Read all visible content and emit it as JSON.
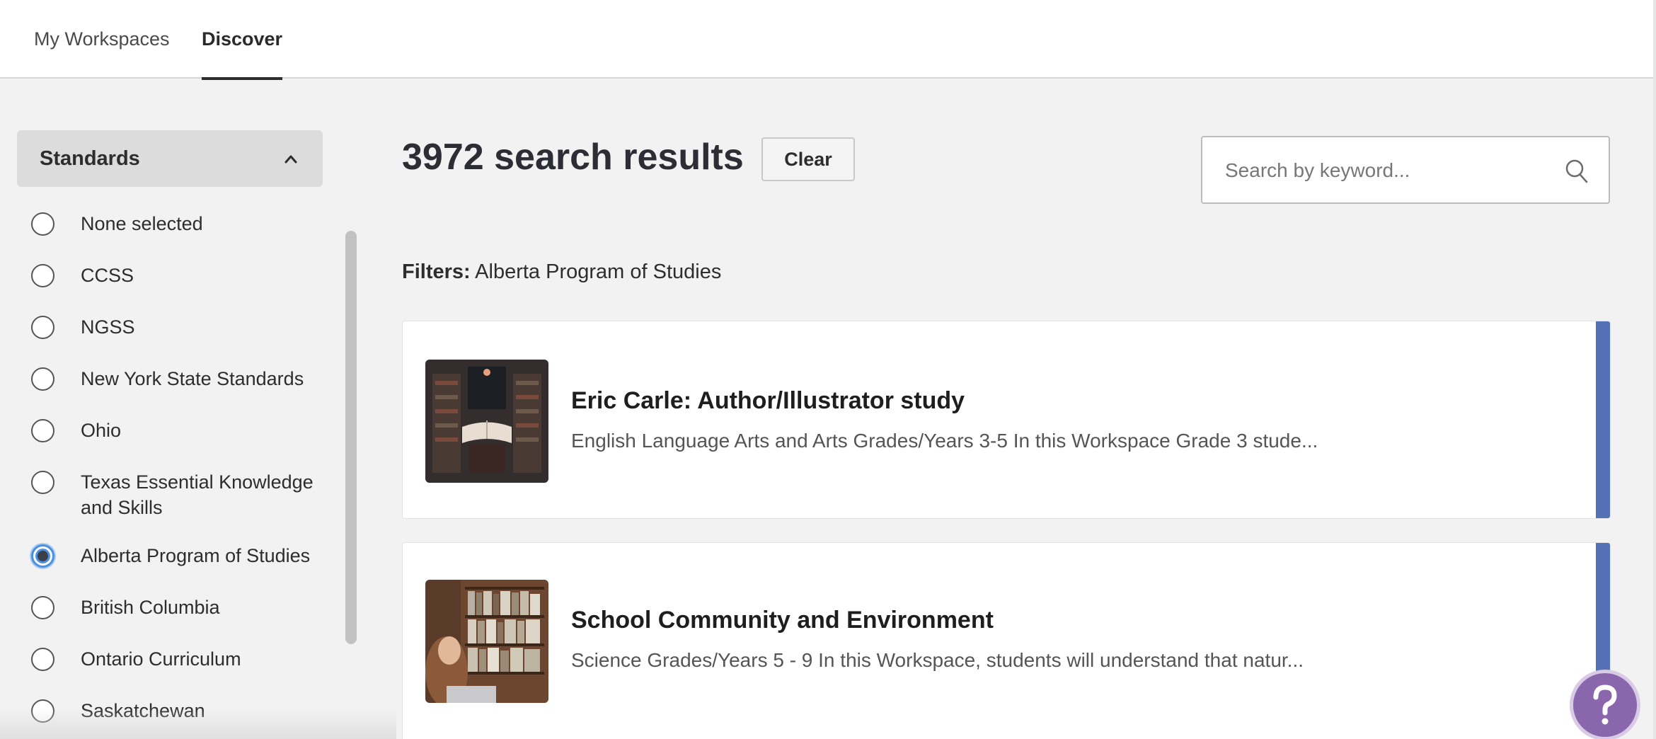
{
  "nav": {
    "tabs": [
      {
        "label": "My Workspaces",
        "active": false
      },
      {
        "label": "Discover",
        "active": true
      }
    ]
  },
  "sidebar": {
    "section_title": "Standards",
    "options": [
      {
        "label": "None selected",
        "selected": false
      },
      {
        "label": "CCSS",
        "selected": false
      },
      {
        "label": "NGSS",
        "selected": false
      },
      {
        "label": "New York State Standards",
        "selected": false
      },
      {
        "label": "Ohio",
        "selected": false
      },
      {
        "label": "Texas Essential Knowledge and Skills",
        "selected": false
      },
      {
        "label": "Alberta Program of Studies",
        "selected": true
      },
      {
        "label": "British Columbia",
        "selected": false
      },
      {
        "label": "Ontario Curriculum",
        "selected": false
      },
      {
        "label": "Saskatchewan",
        "selected": false
      }
    ]
  },
  "main": {
    "results_count": "3972 search results",
    "clear_label": "Clear",
    "search_placeholder": "Search by keyword...",
    "filters_label": "Filters:",
    "filters_value": "Alberta Program of Studies",
    "results": [
      {
        "title": "Eric Carle: Author/Illustrator study",
        "description": "English Language Arts and Arts Grades/Years 3-5 In this Workspace Grade 3 stude..."
      },
      {
        "title": "School Community and Environment",
        "description": "Science Grades/Years 5 - 9 In this Workspace, students will understand that natur..."
      }
    ]
  },
  "colors": {
    "accent_bar": "#5571b5",
    "radio_selected": "#4a8fe0",
    "help_button": "#8a67ad"
  },
  "icons": {
    "section_toggle": "chevron-up-icon",
    "search": "search-icon",
    "help": "question-mark-icon"
  }
}
